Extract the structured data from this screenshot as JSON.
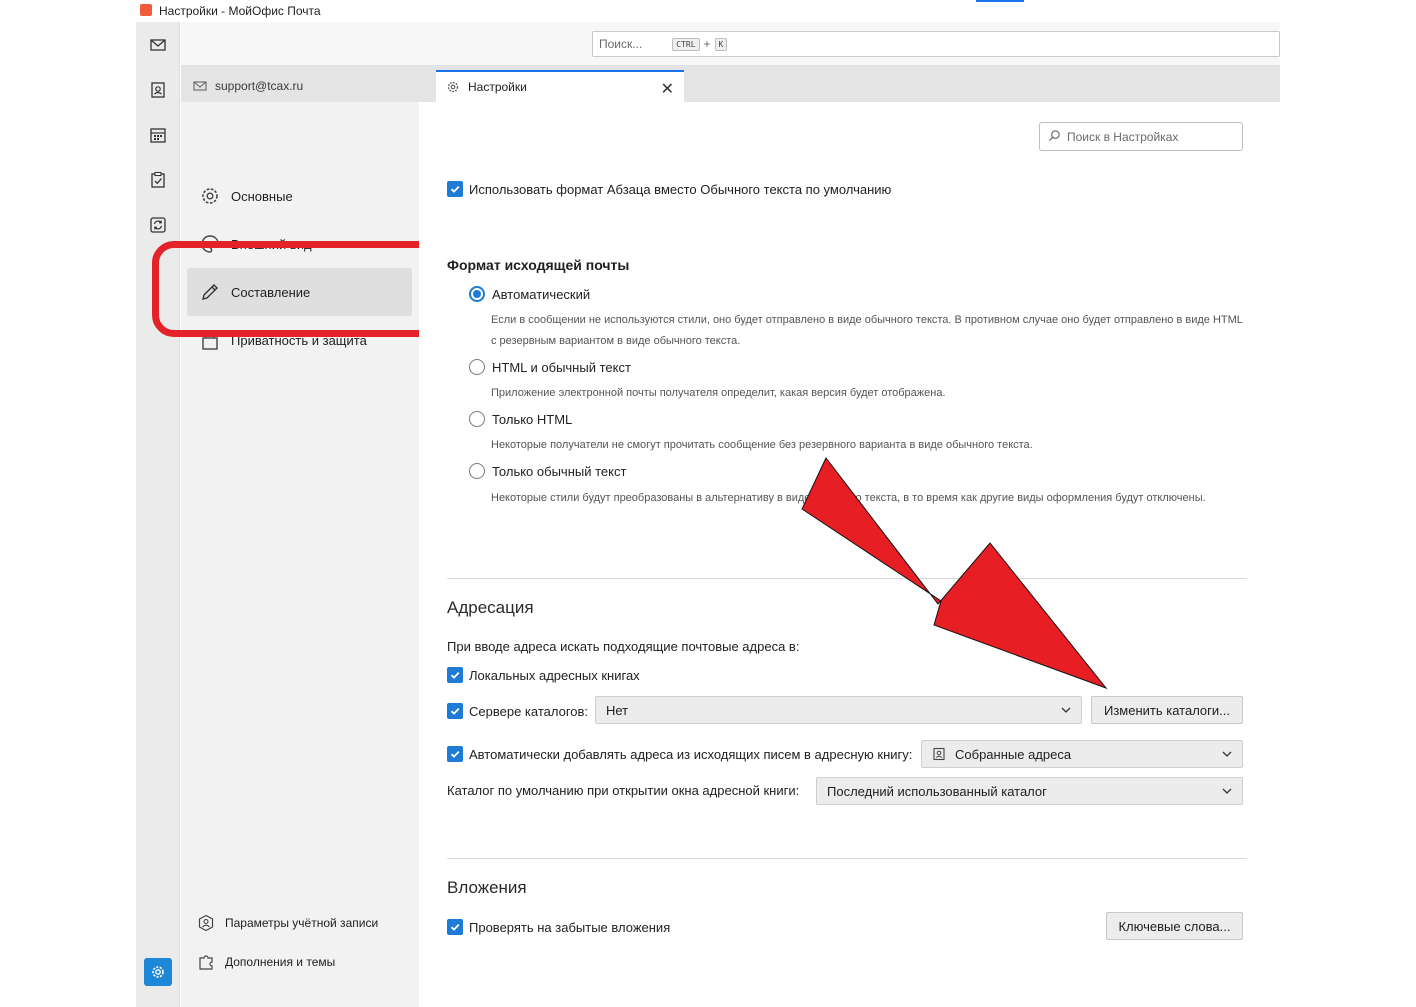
{
  "window": {
    "title": "Настройки - МойОфис Почта"
  },
  "topbar": {
    "search_placeholder": "Поиск...",
    "shortcut_ctrl": "CTRL",
    "shortcut_plus": "+",
    "shortcut_key": "K"
  },
  "tabs": [
    {
      "label": "support@tcax.ru"
    },
    {
      "label": "Настройки",
      "close": "✕"
    }
  ],
  "nav": {
    "items": [
      {
        "label": "Основные"
      },
      {
        "label": "Внешний вид"
      },
      {
        "label": "Составление"
      },
      {
        "label": "Приватность и защита"
      }
    ],
    "footer": [
      {
        "label": "Параметры учётной записи"
      },
      {
        "label": "Дополнения и темы"
      }
    ]
  },
  "settings_search": {
    "placeholder": "Поиск в Настройках"
  },
  "composition": {
    "paragraph_format_label": "Использовать формат Абзаца вместо Обычного текста по умолчанию",
    "paragraph_format_checked": true,
    "outgoing_heading": "Формат исходящей почты",
    "outgoing_options": [
      {
        "label": "Автоматический",
        "selected": true,
        "desc": "Если в сообщении не используются стили, оно будет отправлено в виде обычного текста. В противном случае оно будет отправлено в виде HTML с резервным вариантом в виде обычного текста."
      },
      {
        "label": "HTML и обычный текст",
        "selected": false,
        "desc": "Приложение электронной почты получателя определит, какая версия будет отображена."
      },
      {
        "label": "Только HTML",
        "selected": false,
        "desc": "Некоторые получатели не смогут прочитать сообщение без резервного варианта в виде обычного текста."
      },
      {
        "label": "Только обычный текст",
        "selected": false,
        "desc": "Некоторые стили будут преобразованы в альтернативу в виде обычного текста, в то время как другие виды оформления будут отключены."
      }
    ]
  },
  "addressing": {
    "title": "Адресация",
    "intro": "При вводе адреса искать подходящие почтовые адреса в:",
    "local_books_label": "Локальных адресных книгах",
    "local_books_checked": true,
    "directory_server_label": "Сервере каталогов:",
    "directory_server_checked": true,
    "directory_server_value": "Нет",
    "edit_directories_button": "Изменить каталоги...",
    "auto_add_label": "Автоматически добавлять адреса из исходящих писем в адресную книгу:",
    "auto_add_checked": true,
    "auto_add_value": "Собранные адреса",
    "default_dir_label": "Каталог по умолчанию при открытии окна адресной книги:",
    "default_dir_value": "Последний использованный каталог"
  },
  "attachments": {
    "title": "Вложения",
    "check_forgotten_label": "Проверять на забытые вложения",
    "check_forgotten_checked": true,
    "keywords_button": "Ключевые слова..."
  },
  "colors": {
    "accent": "#1e7bd6",
    "annotation_red": "#e3222a"
  }
}
